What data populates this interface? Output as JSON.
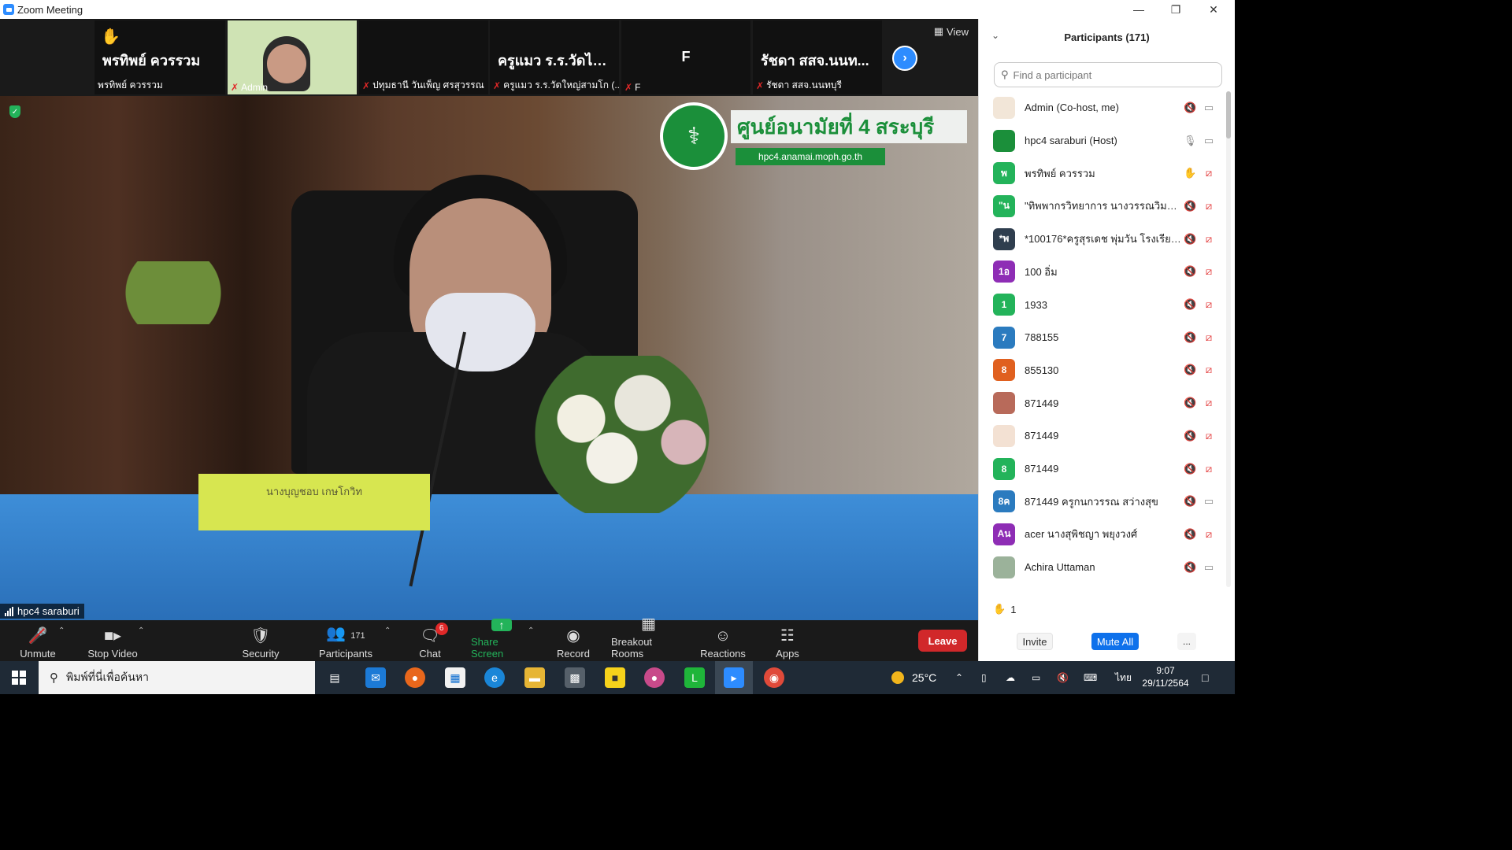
{
  "window": {
    "title": "Zoom Meeting",
    "minimize_icon": "minimize-icon",
    "restore_icon": "restore-icon",
    "close_icon": "close-icon"
  },
  "stage": {
    "view_label": "View",
    "thumbnails": [
      {
        "big_text": "พรทิพย์ ควรรวม",
        "label": "พรทิพย์ ควรรวม",
        "hand_raised": true,
        "muted": false
      },
      {
        "big_text": "",
        "label": "Admin",
        "hand_raised": false,
        "muted": true,
        "video": true
      },
      {
        "big_text": "",
        "label": "ปทุมธานี วันเพ็ญ ศรสุวรรณ",
        "hand_raised": false,
        "muted": true
      },
      {
        "big_text": "ครูแมว ร.ร.วัดไห...",
        "label": "ครูแมว ร.ร.วัดใหญ่สามโก (...",
        "hand_raised": false,
        "muted": true
      },
      {
        "big_text": "F",
        "label": "F",
        "hand_raised": false,
        "muted": true
      },
      {
        "big_text": "รัชดา สสจ.นนท...",
        "label": "รัชดา สสจ.นนทบุรี",
        "hand_raised": false,
        "muted": true
      }
    ],
    "main_speaker_label": "hpc4 saraburi",
    "logo_text": "ศูนย์อนามัยที่ 4 สระบุรี",
    "logo_url": "hpc4.anamai.moph.go.th",
    "nameplate_text": "นางบุญชอบ เกษโกวิท"
  },
  "toolbar": {
    "unmute": "Unmute",
    "stop_video": "Stop Video",
    "security": "Security",
    "participants": "Participants",
    "participants_count": "171",
    "chat": "Chat",
    "chat_badge": "6",
    "share_screen": "Share Screen",
    "record": "Record",
    "breakout": "Breakout Rooms",
    "reactions": "Reactions",
    "apps": "Apps",
    "leave": "Leave"
  },
  "panel": {
    "title": "Participants (171)",
    "search_placeholder": "Find a participant",
    "participants": [
      {
        "name": "Admin (Co-host, me)",
        "avatar_text": "",
        "avatar_color": "#f2e6d8",
        "mic": "muted",
        "cam": "on"
      },
      {
        "name": "hpc4 saraburi (Host)",
        "avatar_text": "",
        "avatar_color": "#1b8f3a",
        "mic": "on",
        "cam": "on"
      },
      {
        "name": "พรทิพย์ ควรรวม",
        "avatar_text": "พ",
        "avatar_color": "#23b35a",
        "mic": "hand",
        "cam": "off"
      },
      {
        "name": "\"ทิพพากรวิทยาการ นางวรรณวิมล คล้า...",
        "avatar_text": "\"น",
        "avatar_color": "#23b35a",
        "mic": "muted",
        "cam": "off"
      },
      {
        "name": "*100176*ครูสุรเดช พุ่มวัน  โรงเรียนวั...",
        "avatar_text": "*พ",
        "avatar_color": "#2f3e4e",
        "mic": "muted",
        "cam": "off"
      },
      {
        "name": "100 อิ่ม",
        "avatar_text": "1อ",
        "avatar_color": "#8e2db5",
        "mic": "muted",
        "cam": "off"
      },
      {
        "name": "1933",
        "avatar_text": "1",
        "avatar_color": "#23b35a",
        "mic": "muted",
        "cam": "off"
      },
      {
        "name": "788155",
        "avatar_text": "7",
        "avatar_color": "#2b7bbf",
        "mic": "muted",
        "cam": "off"
      },
      {
        "name": "855130",
        "avatar_text": "8",
        "avatar_color": "#e0601f",
        "mic": "muted",
        "cam": "off"
      },
      {
        "name": "871449",
        "avatar_text": "",
        "avatar_color": "#b86a5a",
        "mic": "muted",
        "cam": "off"
      },
      {
        "name": "871449",
        "avatar_text": "",
        "avatar_color": "#f3e1d3",
        "mic": "muted",
        "cam": "off"
      },
      {
        "name": "871449",
        "avatar_text": "8",
        "avatar_color": "#23b35a",
        "mic": "muted",
        "cam": "off"
      },
      {
        "name": "871449 ครูกนกวรรณ สว่างสุข",
        "avatar_text": "8ค",
        "avatar_color": "#2b7bbf",
        "mic": "muted",
        "cam": "on"
      },
      {
        "name": "acer นางสุพิชญา พยุงวงศ์",
        "avatar_text": "Aน",
        "avatar_color": "#8e2db5",
        "mic": "muted",
        "cam": "off"
      },
      {
        "name": "Achira Uttaman",
        "avatar_text": "",
        "avatar_color": "#9bb29a",
        "mic": "muted",
        "cam": "on"
      }
    ],
    "hand_count": "1",
    "invite": "Invite",
    "mute_all": "Mute All",
    "more": "..."
  },
  "taskbar": {
    "search_placeholder": "พิมพ์ที่นี่เพื่อค้นหา",
    "temperature": "25°C",
    "language": "ไทย",
    "time": "9:07",
    "date": "29/11/2564"
  }
}
